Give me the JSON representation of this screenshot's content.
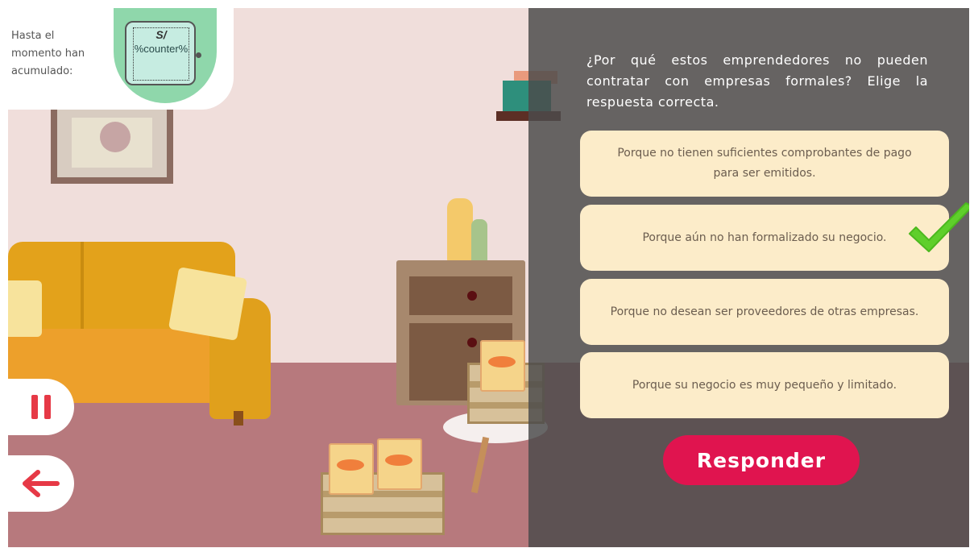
{
  "counter": {
    "label": "Hasta el momento han acumulado:",
    "currency": "S/",
    "value": "%counter%"
  },
  "question": {
    "text": "¿Por qué estos emprendedores no pueden contratar con empresas formales? Elige la respuesta correcta."
  },
  "options": [
    {
      "text": "Porque no tienen suficientes comprobantes de pago para ser emitidos."
    },
    {
      "text": "Porque aún no han formalizado su negocio.",
      "correct": true
    },
    {
      "text": "Porque no desean ser proveedores de otras empresas."
    },
    {
      "text": "Porque su negocio es muy pequeño y limitado."
    }
  ],
  "respond_button": {
    "label": "Responder"
  },
  "controls": {
    "pause_icon": "pause-icon",
    "back_icon": "arrow-left-icon"
  },
  "colors": {
    "accent": "#e0144f",
    "option_bg": "#fcecc9",
    "check": "#5fcf2b",
    "overlay": "#4b4b4b"
  }
}
